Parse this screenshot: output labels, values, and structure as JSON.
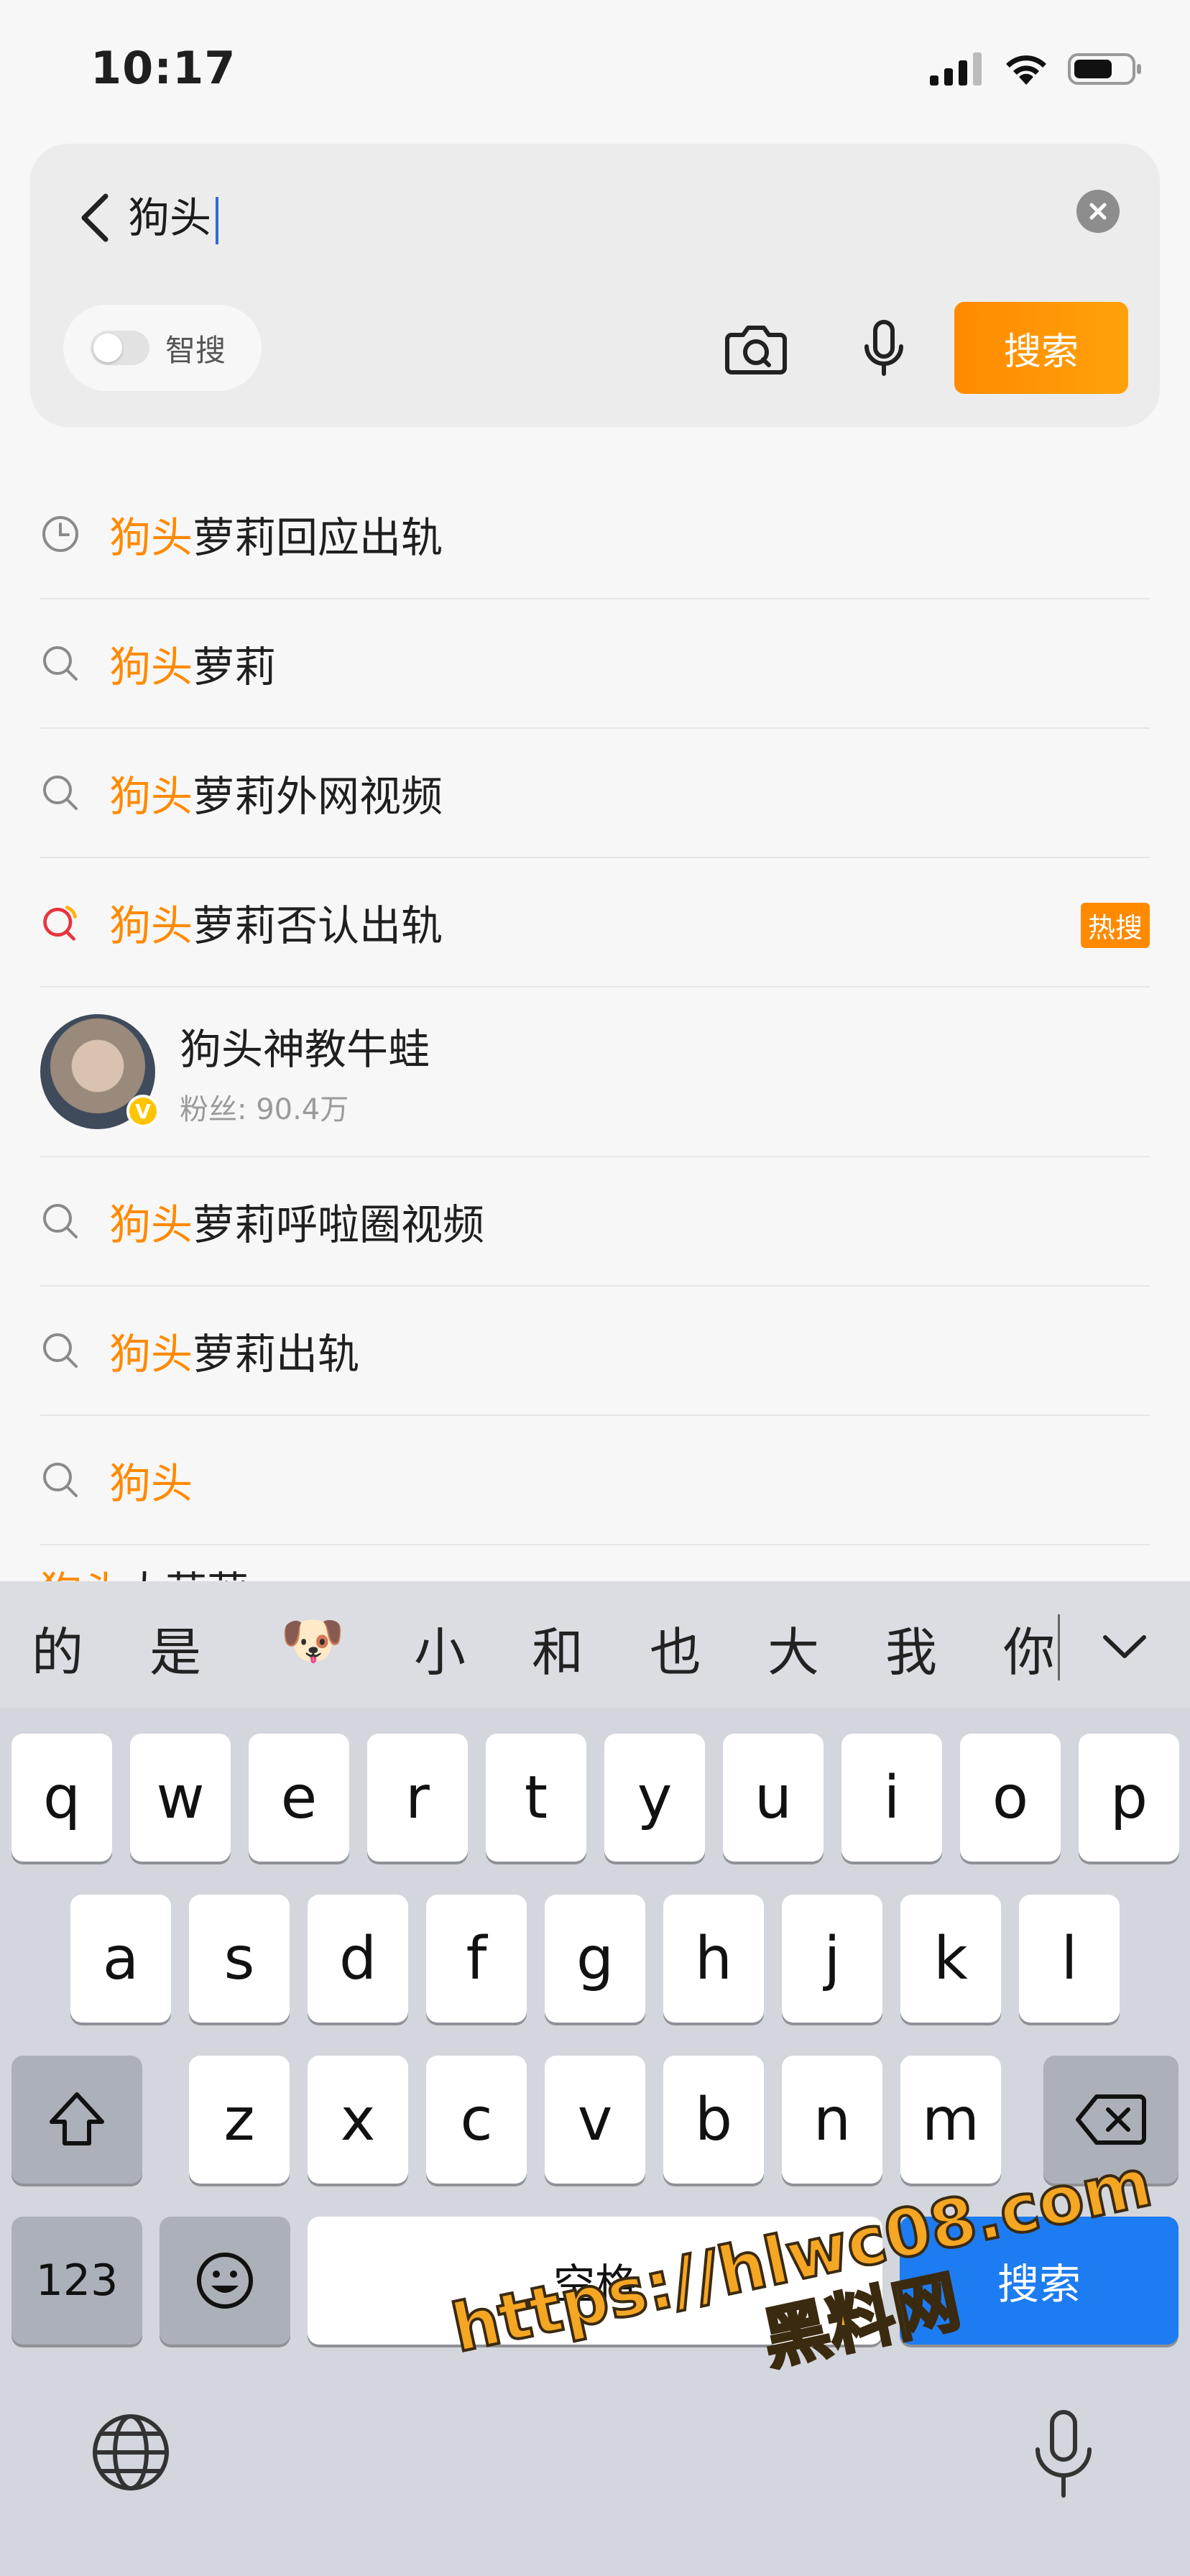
{
  "status_bar": {
    "time": "10:17"
  },
  "search": {
    "query": "狗头",
    "smart_toggle_label": "智搜",
    "search_button_label": "搜索"
  },
  "suggestions": [
    {
      "kind": "history",
      "highlight": "狗头",
      "rest": "萝莉回应出轨"
    },
    {
      "kind": "search",
      "highlight": "狗头",
      "rest": "萝莉"
    },
    {
      "kind": "search",
      "highlight": "狗头",
      "rest": "萝莉外网视频"
    },
    {
      "kind": "hot",
      "highlight": "狗头",
      "rest": "萝莉否认出轨",
      "badge": "热搜"
    },
    {
      "kind": "user",
      "name": "狗头神教牛蛙",
      "fans": "粉丝: 90.4万"
    },
    {
      "kind": "search",
      "highlight": "狗头",
      "rest": "萝莉呼啦圈视频"
    },
    {
      "kind": "search",
      "highlight": "狗头",
      "rest": "萝莉出轨"
    },
    {
      "kind": "search",
      "highlight": "狗头",
      "rest": ""
    }
  ],
  "peek_row": {
    "highlight": "狗头",
    "rest": "大萝莉"
  },
  "keyboard": {
    "candidates": [
      "的",
      "是",
      "🐶",
      "小",
      "和",
      "也",
      "大",
      "我",
      "你"
    ],
    "row1": [
      "q",
      "w",
      "e",
      "r",
      "t",
      "y",
      "u",
      "i",
      "o",
      "p"
    ],
    "row2": [
      "a",
      "s",
      "d",
      "f",
      "g",
      "h",
      "j",
      "k",
      "l"
    ],
    "row3": [
      "z",
      "x",
      "c",
      "v",
      "b",
      "n",
      "m"
    ],
    "num_label": "123",
    "space_label": "空格",
    "action_label": "搜索"
  },
  "watermark": {
    "line1": "https://hlwc08.com",
    "line2": "黑料网"
  },
  "colors": {
    "accent": "#ff8a00",
    "keyboard_action": "#1e7cf2",
    "hot_icon": "#e8343f"
  }
}
